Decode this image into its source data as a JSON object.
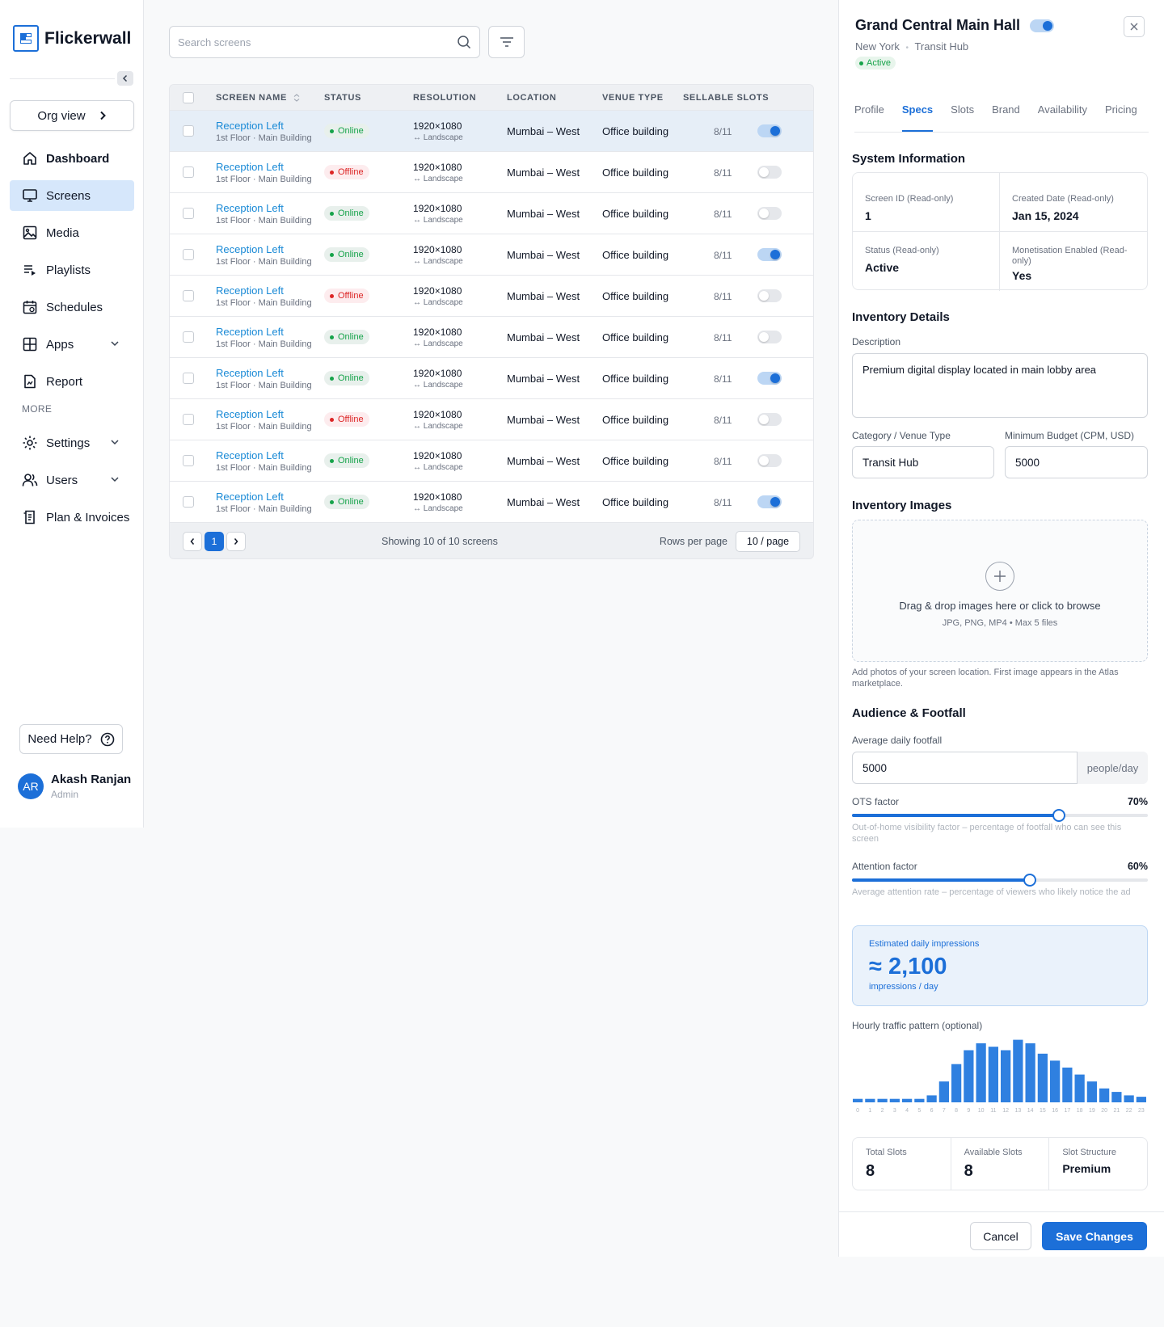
{
  "brand": {
    "name": "Flickerwall"
  },
  "sidebar": {
    "org_button": "Org view",
    "items": [
      {
        "label": "Dashboard",
        "icon": "home-icon"
      },
      {
        "label": "Screens",
        "icon": "monitor-icon"
      },
      {
        "label": "Media",
        "icon": "image-icon"
      },
      {
        "label": "Playlists",
        "icon": "playlist-icon"
      },
      {
        "label": "Schedules",
        "icon": "calendar-icon"
      },
      {
        "label": "Apps",
        "icon": "grid-icon"
      },
      {
        "label": "Report",
        "icon": "report-icon"
      }
    ],
    "more_label": "MORE",
    "more_items": [
      {
        "label": "Settings",
        "icon": "gear-icon"
      },
      {
        "label": "Users",
        "icon": "users-icon"
      },
      {
        "label": "Plan & Invoices",
        "icon": "invoice-icon"
      }
    ],
    "help_button": "Need Help?",
    "user": {
      "initials": "AR",
      "name": "Akash Ranjan",
      "role": "Admin"
    }
  },
  "search": {
    "placeholder": "Search screens"
  },
  "table": {
    "headers": [
      "SCREEN NAME",
      "STATUS",
      "RESOLUTION",
      "LOCATION",
      "VENUE TYPE",
      "SELLABLE SLOTS"
    ],
    "rows": [
      {
        "name": "Reception Left",
        "sub": "1st Floor · Main Building",
        "status": "Online",
        "res": "1920×1080",
        "orient": "↔ Landscape",
        "location": "Mumbai – West",
        "venue": "Office building",
        "slots": "8/11",
        "enabled": true
      },
      {
        "name": "Reception Left",
        "sub": "1st Floor · Main Building",
        "status": "Offline",
        "res": "1920×1080",
        "orient": "↔ Landscape",
        "location": "Mumbai – West",
        "venue": "Office building",
        "slots": "8/11",
        "enabled": false
      },
      {
        "name": "Reception Left",
        "sub": "1st Floor · Main Building",
        "status": "Online",
        "res": "1920×1080",
        "orient": "↔ Landscape",
        "location": "Mumbai – West",
        "venue": "Office building",
        "slots": "8/11",
        "enabled": false
      },
      {
        "name": "Reception Left",
        "sub": "1st Floor · Main Building",
        "status": "Online",
        "res": "1920×1080",
        "orient": "↔ Landscape",
        "location": "Mumbai – West",
        "venue": "Office building",
        "slots": "8/11",
        "enabled": true
      },
      {
        "name": "Reception Left",
        "sub": "1st Floor · Main Building",
        "status": "Offline",
        "res": "1920×1080",
        "orient": "↔ Landscape",
        "location": "Mumbai – West",
        "venue": "Office building",
        "slots": "8/11",
        "enabled": false
      },
      {
        "name": "Reception Left",
        "sub": "1st Floor · Main Building",
        "status": "Online",
        "res": "1920×1080",
        "orient": "↔ Landscape",
        "location": "Mumbai – West",
        "venue": "Office building",
        "slots": "8/11",
        "enabled": false
      },
      {
        "name": "Reception Left",
        "sub": "1st Floor · Main Building",
        "status": "Online",
        "res": "1920×1080",
        "orient": "↔ Landscape",
        "location": "Mumbai – West",
        "venue": "Office building",
        "slots": "8/11",
        "enabled": true
      },
      {
        "name": "Reception Left",
        "sub": "1st Floor · Main Building",
        "status": "Offline",
        "res": "1920×1080",
        "orient": "↔ Landscape",
        "location": "Mumbai – West",
        "venue": "Office building",
        "slots": "8/11",
        "enabled": false
      },
      {
        "name": "Reception Left",
        "sub": "1st Floor · Main Building",
        "status": "Online",
        "res": "1920×1080",
        "orient": "↔ Landscape",
        "location": "Mumbai – West",
        "venue": "Office building",
        "slots": "8/11",
        "enabled": false
      },
      {
        "name": "Reception Left",
        "sub": "1st Floor · Main Building",
        "status": "Online",
        "res": "1920×1080",
        "orient": "↔ Landscape",
        "location": "Mumbai – West",
        "venue": "Office building",
        "slots": "8/11",
        "enabled": true
      }
    ],
    "footer": {
      "current_page": "1",
      "showing": "Showing 10 of 10 screens",
      "rows_per_page_label": "Rows per page",
      "rows_per_page": "10 / page"
    }
  },
  "panel": {
    "title": "Grand Central Main Hall",
    "city": "New York",
    "separator": "•",
    "venue": "Transit Hub",
    "status": "Active",
    "tabs": [
      "Profile",
      "Specs",
      "Slots",
      "Brand",
      "Availability",
      "Pricing"
    ],
    "active_tab": "Specs",
    "system": {
      "title": "System Information",
      "screen_id_label": "Screen ID (Read-only)",
      "screen_id": "1",
      "created_label": "Created Date (Read-only)",
      "created": "Jan 15, 2024",
      "status_label": "Status (Read-only)",
      "status": "Active",
      "monet_label": "Monetisation Enabled (Read-only)",
      "monet": "Yes"
    },
    "inventory": {
      "title": "Inventory Details",
      "desc_label": "Description",
      "desc": "Premium digital display located in main lobby area",
      "category_label": "Category / Venue Type",
      "category": "Transit Hub",
      "budget_label": "Minimum Budget (CPM, USD)",
      "budget": "5000"
    },
    "images": {
      "title": "Inventory Images",
      "drop_text": "Drag & drop images here or click to browse",
      "drop_sub": "JPG, PNG, MP4 • Max 5 files",
      "help": "Add photos of your screen location. First image appears in the Atlas marketplace."
    },
    "audience": {
      "title": "Audience & Footfall",
      "footfall_label": "Average daily footfall",
      "footfall": "5000",
      "footfall_unit": "people/day",
      "ots_label": "OTS factor",
      "ots_pct": "70%",
      "ots_value": 0.7,
      "ots_help": "Out-of-home visibility factor – percentage of footfall who can see this screen",
      "att_label": "Attention factor",
      "att_pct": "60%",
      "att_value": 0.6,
      "att_help": "Average attention rate – percentage of viewers who likely notice the ad"
    },
    "impressions": {
      "label": "Estimated daily impressions",
      "value": "≈ 2,100",
      "unit": "impressions / day"
    },
    "traffic_label": "Hourly traffic pattern (optional)",
    "chart_data": {
      "type": "bar",
      "categories": [
        "0",
        "1",
        "2",
        "3",
        "4",
        "5",
        "6",
        "7",
        "8",
        "9",
        "10",
        "11",
        "12",
        "13",
        "14",
        "15",
        "16",
        "17",
        "18",
        "19",
        "20",
        "21",
        "22",
        "23"
      ],
      "values": [
        5,
        5,
        5,
        5,
        5,
        5,
        10,
        30,
        55,
        75,
        85,
        80,
        75,
        90,
        85,
        70,
        60,
        50,
        40,
        30,
        20,
        15,
        10,
        8
      ],
      "ylim": [
        0,
        100
      ],
      "color": "#2f80e0"
    },
    "slots": {
      "total_label": "Total Slots",
      "total": "8",
      "avail_label": "Available Slots",
      "avail": "8",
      "structure_label": "Slot Structure",
      "structure": "Premium"
    },
    "cancel": "Cancel",
    "save": "Save Changes"
  },
  "colors": {
    "accent": "#1c6fd8",
    "online": "#16a34a",
    "offline": "#dc2626",
    "link": "#1a8ad6"
  }
}
